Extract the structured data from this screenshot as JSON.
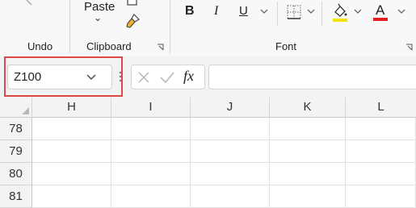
{
  "ribbon": {
    "paste_label": "Paste",
    "paste_arrow": "⌄",
    "groups": {
      "undo": "Undo",
      "clipboard": "Clipboard",
      "font": "Font"
    },
    "font_buttons": {
      "bold": "B",
      "italic": "I",
      "underline": "U",
      "font_color_letter": "A"
    },
    "colors": {
      "highlight": "#f5e400",
      "font_color": "#e02020"
    }
  },
  "formula_bar": {
    "name_box_value": "Z100",
    "fx_label": "fx",
    "formula_value": ""
  },
  "sheet": {
    "columns": [
      "H",
      "I",
      "J",
      "K",
      "L"
    ],
    "rows": [
      "78",
      "79",
      "80",
      "81"
    ]
  },
  "accent": {
    "annotation_border": "#e04848"
  }
}
